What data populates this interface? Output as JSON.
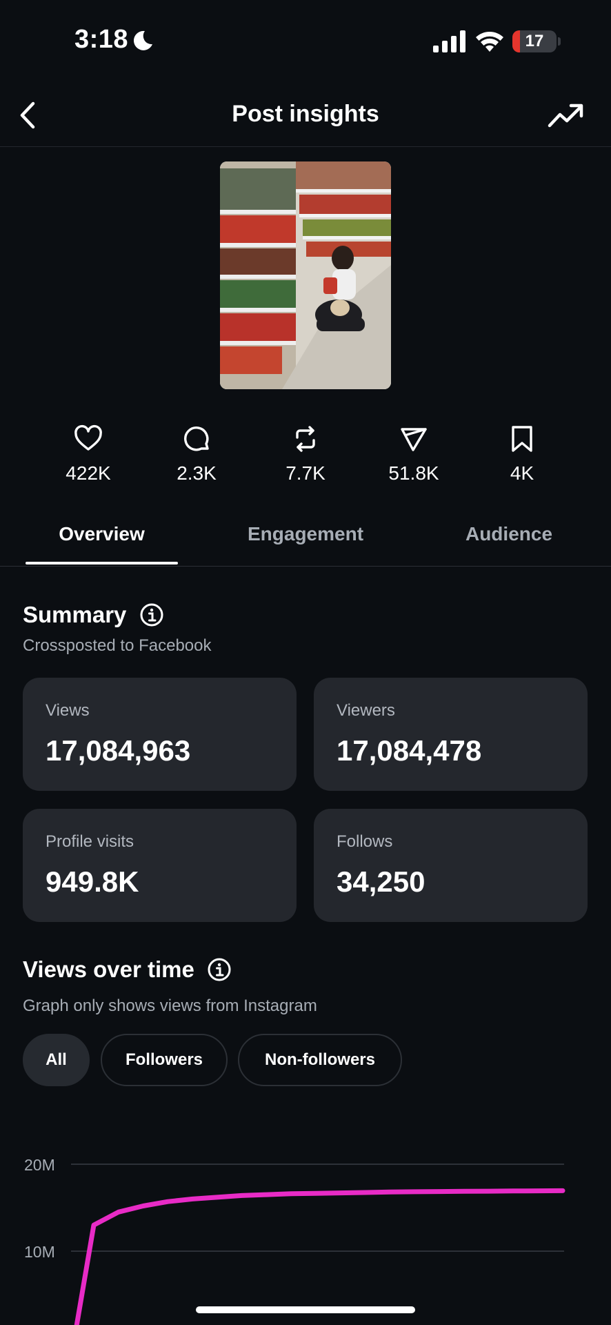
{
  "status_bar": {
    "time": "3:18",
    "battery": "17",
    "battery_level": 0.17,
    "icons": [
      "moon-icon",
      "cellular-signal-icon",
      "wifi-icon",
      "battery-icon"
    ]
  },
  "header": {
    "title": "Post insights",
    "back_icon": "chevron-left-icon",
    "trend_icon": "trending-up-icon"
  },
  "post": {
    "thumbnail": "post-thumbnail"
  },
  "metrics": [
    {
      "icon": "heart-icon",
      "value": "422K"
    },
    {
      "icon": "comment-icon",
      "value": "2.3K"
    },
    {
      "icon": "repost-icon",
      "value": "7.7K"
    },
    {
      "icon": "share-icon",
      "value": "51.8K"
    },
    {
      "icon": "bookmark-icon",
      "value": "4K"
    }
  ],
  "tabs": [
    {
      "label": "Overview",
      "active": true
    },
    {
      "label": "Engagement",
      "active": false
    },
    {
      "label": "Audience",
      "active": false
    }
  ],
  "summary": {
    "title": "Summary",
    "subtitle": "Crossposted to Facebook",
    "cards": [
      {
        "label": "Views",
        "value": "17,084,963"
      },
      {
        "label": "Viewers",
        "value": "17,084,478"
      },
      {
        "label": "Profile visits",
        "value": "949.8K"
      },
      {
        "label": "Follows",
        "value": "34,250"
      }
    ]
  },
  "views_over_time": {
    "title": "Views over time",
    "subtitle": "Graph only shows views from Instagram",
    "filters": [
      {
        "label": "All",
        "active": true
      },
      {
        "label": "Followers",
        "active": false
      },
      {
        "label": "Non-followers",
        "active": false
      }
    ]
  },
  "chart_data": {
    "type": "line",
    "title": "",
    "xlabel": "",
    "ylabel": "",
    "y_ticks": [
      "20M",
      "10M"
    ],
    "y_tick_values": [
      20000000,
      10000000
    ],
    "ylim": [
      0,
      20000000
    ],
    "grid": true,
    "color": "#e82bc6",
    "series": [
      {
        "x": [
          0,
          1,
          2,
          3,
          4,
          5,
          6,
          7,
          8,
          9,
          10,
          11,
          12,
          13,
          14,
          15,
          16,
          17,
          18,
          19,
          20
        ],
        "values": [
          0,
          13000000,
          14500000,
          15200000,
          15700000,
          16000000,
          16200000,
          16400000,
          16500000,
          16600000,
          16650000,
          16700000,
          16750000,
          16800000,
          16830000,
          16860000,
          16880000,
          16900000,
          16920000,
          16940000,
          16950000
        ]
      }
    ]
  },
  "colors": {
    "background": "#0b0e12",
    "card": "#24272d",
    "muted_text": "#a7adb5",
    "line": "#e82bc6",
    "battery": "#e5352d"
  }
}
